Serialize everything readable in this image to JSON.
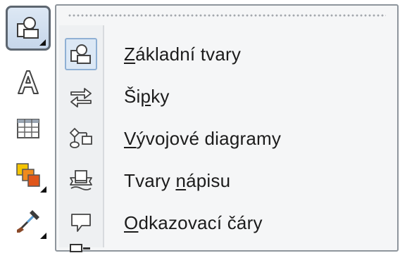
{
  "toolbar": {
    "tools": [
      {
        "icon": "basic-shapes-tool-icon",
        "active": true
      },
      {
        "icon": "text-tool-icon"
      },
      {
        "icon": "table-tool-icon"
      },
      {
        "icon": "interactive-fill-tool-icon"
      },
      {
        "icon": "eyedropper-tool-icon"
      }
    ]
  },
  "menu": {
    "items": [
      {
        "pre": "",
        "hotkey": "Z",
        "post": "ákladní tvary",
        "icon": "basic-shapes-icon",
        "checked": true
      },
      {
        "pre": "Ši",
        "hotkey": "p",
        "post": "ky",
        "icon": "arrow-shapes-icon"
      },
      {
        "pre": "",
        "hotkey": "V",
        "post": "ývojové diagramy",
        "icon": "flowchart-shapes-icon"
      },
      {
        "pre": "Tvary ",
        "hotkey": "n",
        "post": "ápisu",
        "icon": "banner-shapes-icon"
      },
      {
        "pre": "",
        "hotkey": "O",
        "post": "dkazovací čáry",
        "icon": "callout-shapes-icon"
      }
    ]
  },
  "colors": {
    "menu_bg": "#f5f6f7",
    "border": "#8e959c",
    "highlight": "#dce8f5",
    "fill_orange": "#f08a1c",
    "fill_yellow": "#f5c400"
  }
}
